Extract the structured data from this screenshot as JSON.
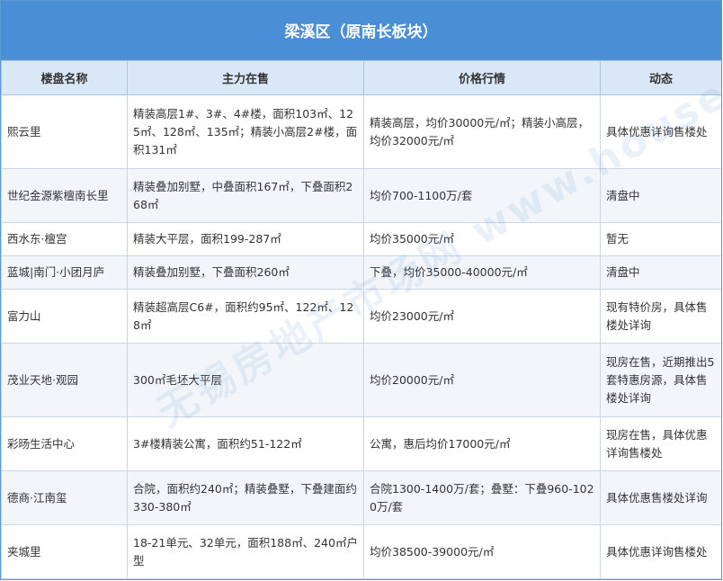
{
  "title": "梁溪区（原南长板块）",
  "headers": [
    "楼盘名称",
    "主力在售",
    "价格行情",
    "动态"
  ],
  "rows": [
    {
      "name": "熙云里",
      "sale": "精装高层1#、3#、4#楼，面积103㎡、125㎡、128㎡、135㎡；精装小高层2#楼，面积131㎡",
      "price": "精装高层，均价30000元/㎡；精装小高层，均价32000元/㎡",
      "status": "具体优惠详询售楼处"
    },
    {
      "name": "世纪金源紫檀南长里",
      "sale": "精装叠加别墅，中叠面积167㎡，下叠面积268㎡",
      "price": "均价700-1100万/套",
      "status": "清盘中"
    },
    {
      "name": "西水东·檀宫",
      "sale": "精装大平层，面积199-287㎡",
      "price": "均价35000元/㎡",
      "status": "暂无"
    },
    {
      "name": "蓝城|南门·小团月庐",
      "sale": "精装叠加别墅，下叠面积260㎡",
      "price": "下叠，均价35000-40000元/㎡",
      "status": "清盘中"
    },
    {
      "name": "富力山",
      "sale": "精装超高层C6#，面积约95㎡、122㎡、128㎡",
      "price": "均价23000元/㎡",
      "status": "现有特价房，具体售楼处详询"
    },
    {
      "name": "茂业天地·观园",
      "sale": "300㎡毛坯大平层",
      "price": "均价20000元/㎡",
      "status": "现房在售，近期推出5套特惠房源，具体售楼处详询"
    },
    {
      "name": "彩旸生活中心",
      "sale": "3#楼精装公寓，面积约51-122㎡",
      "price": "公寓，惠后均价17000元/㎡",
      "status": "现房在售，具体优惠详询售楼处"
    },
    {
      "name": "德商·江南玺",
      "sale": "合院，面积约240㎡；精装叠墅，下叠建面约330-380㎡",
      "price": "合院1300-1400万/套；叠墅：下叠960-1020万/套",
      "status": "具体优惠售楼处详询"
    },
    {
      "name": "夹城里",
      "sale": "18-21单元、32单元，面积188㎡、240㎡户型",
      "price": "均价38500-39000元/㎡",
      "status": "具体优惠详询售楼处"
    }
  ],
  "watermark": "无锡房地产市场网 www.house365.com"
}
